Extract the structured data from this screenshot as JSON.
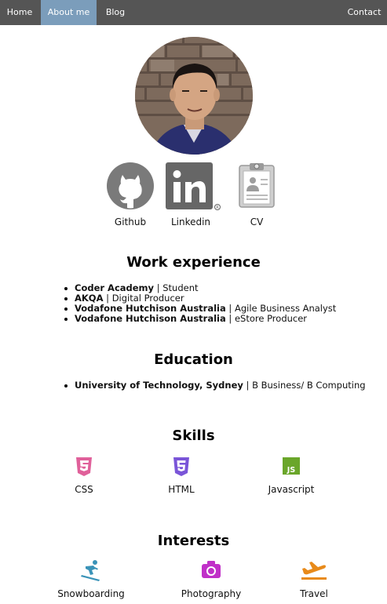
{
  "nav": {
    "home": "Home",
    "about": "About me",
    "blog": "Blog",
    "contact": "Contact",
    "active_color": "#7b9dbb",
    "bar_color": "#555555"
  },
  "profile_links": [
    {
      "label": "Github",
      "icon": "github-icon"
    },
    {
      "label": "Linkedin",
      "icon": "linkedin-icon"
    },
    {
      "label": "CV",
      "icon": "clipboard-icon"
    }
  ],
  "work": {
    "heading": "Work experience",
    "items": [
      {
        "org": "Coder Academy",
        "role": "Student"
      },
      {
        "org": "AKQA",
        "role": "Digital Producer"
      },
      {
        "org": "Vodafone Hutchison Australia",
        "role": "Agile Business Analyst"
      },
      {
        "org": "Vodafone Hutchison Australia",
        "role": "eStore Producer"
      }
    ]
  },
  "education": {
    "heading": "Education",
    "items": [
      {
        "org": "University of Technology, Sydney",
        "role": "B Business/ B Computing"
      }
    ]
  },
  "skills": {
    "heading": "Skills",
    "items": [
      {
        "label": "CSS",
        "icon": "css3-icon",
        "color": "#e0609a"
      },
      {
        "label": "HTML",
        "icon": "html5-icon",
        "color": "#7a55d8"
      },
      {
        "label": "Javascript",
        "icon": "js-icon",
        "color": "#6aa62a"
      }
    ]
  },
  "interests": {
    "heading": "Interests",
    "items": [
      {
        "label": "Snowboarding",
        "icon": "snowboarding-icon",
        "color": "#3a93b8"
      },
      {
        "label": "Photography",
        "icon": "camera-icon",
        "color": "#c030c8"
      },
      {
        "label": "Travel",
        "icon": "airplane-icon",
        "color": "#e88a1a"
      }
    ]
  }
}
